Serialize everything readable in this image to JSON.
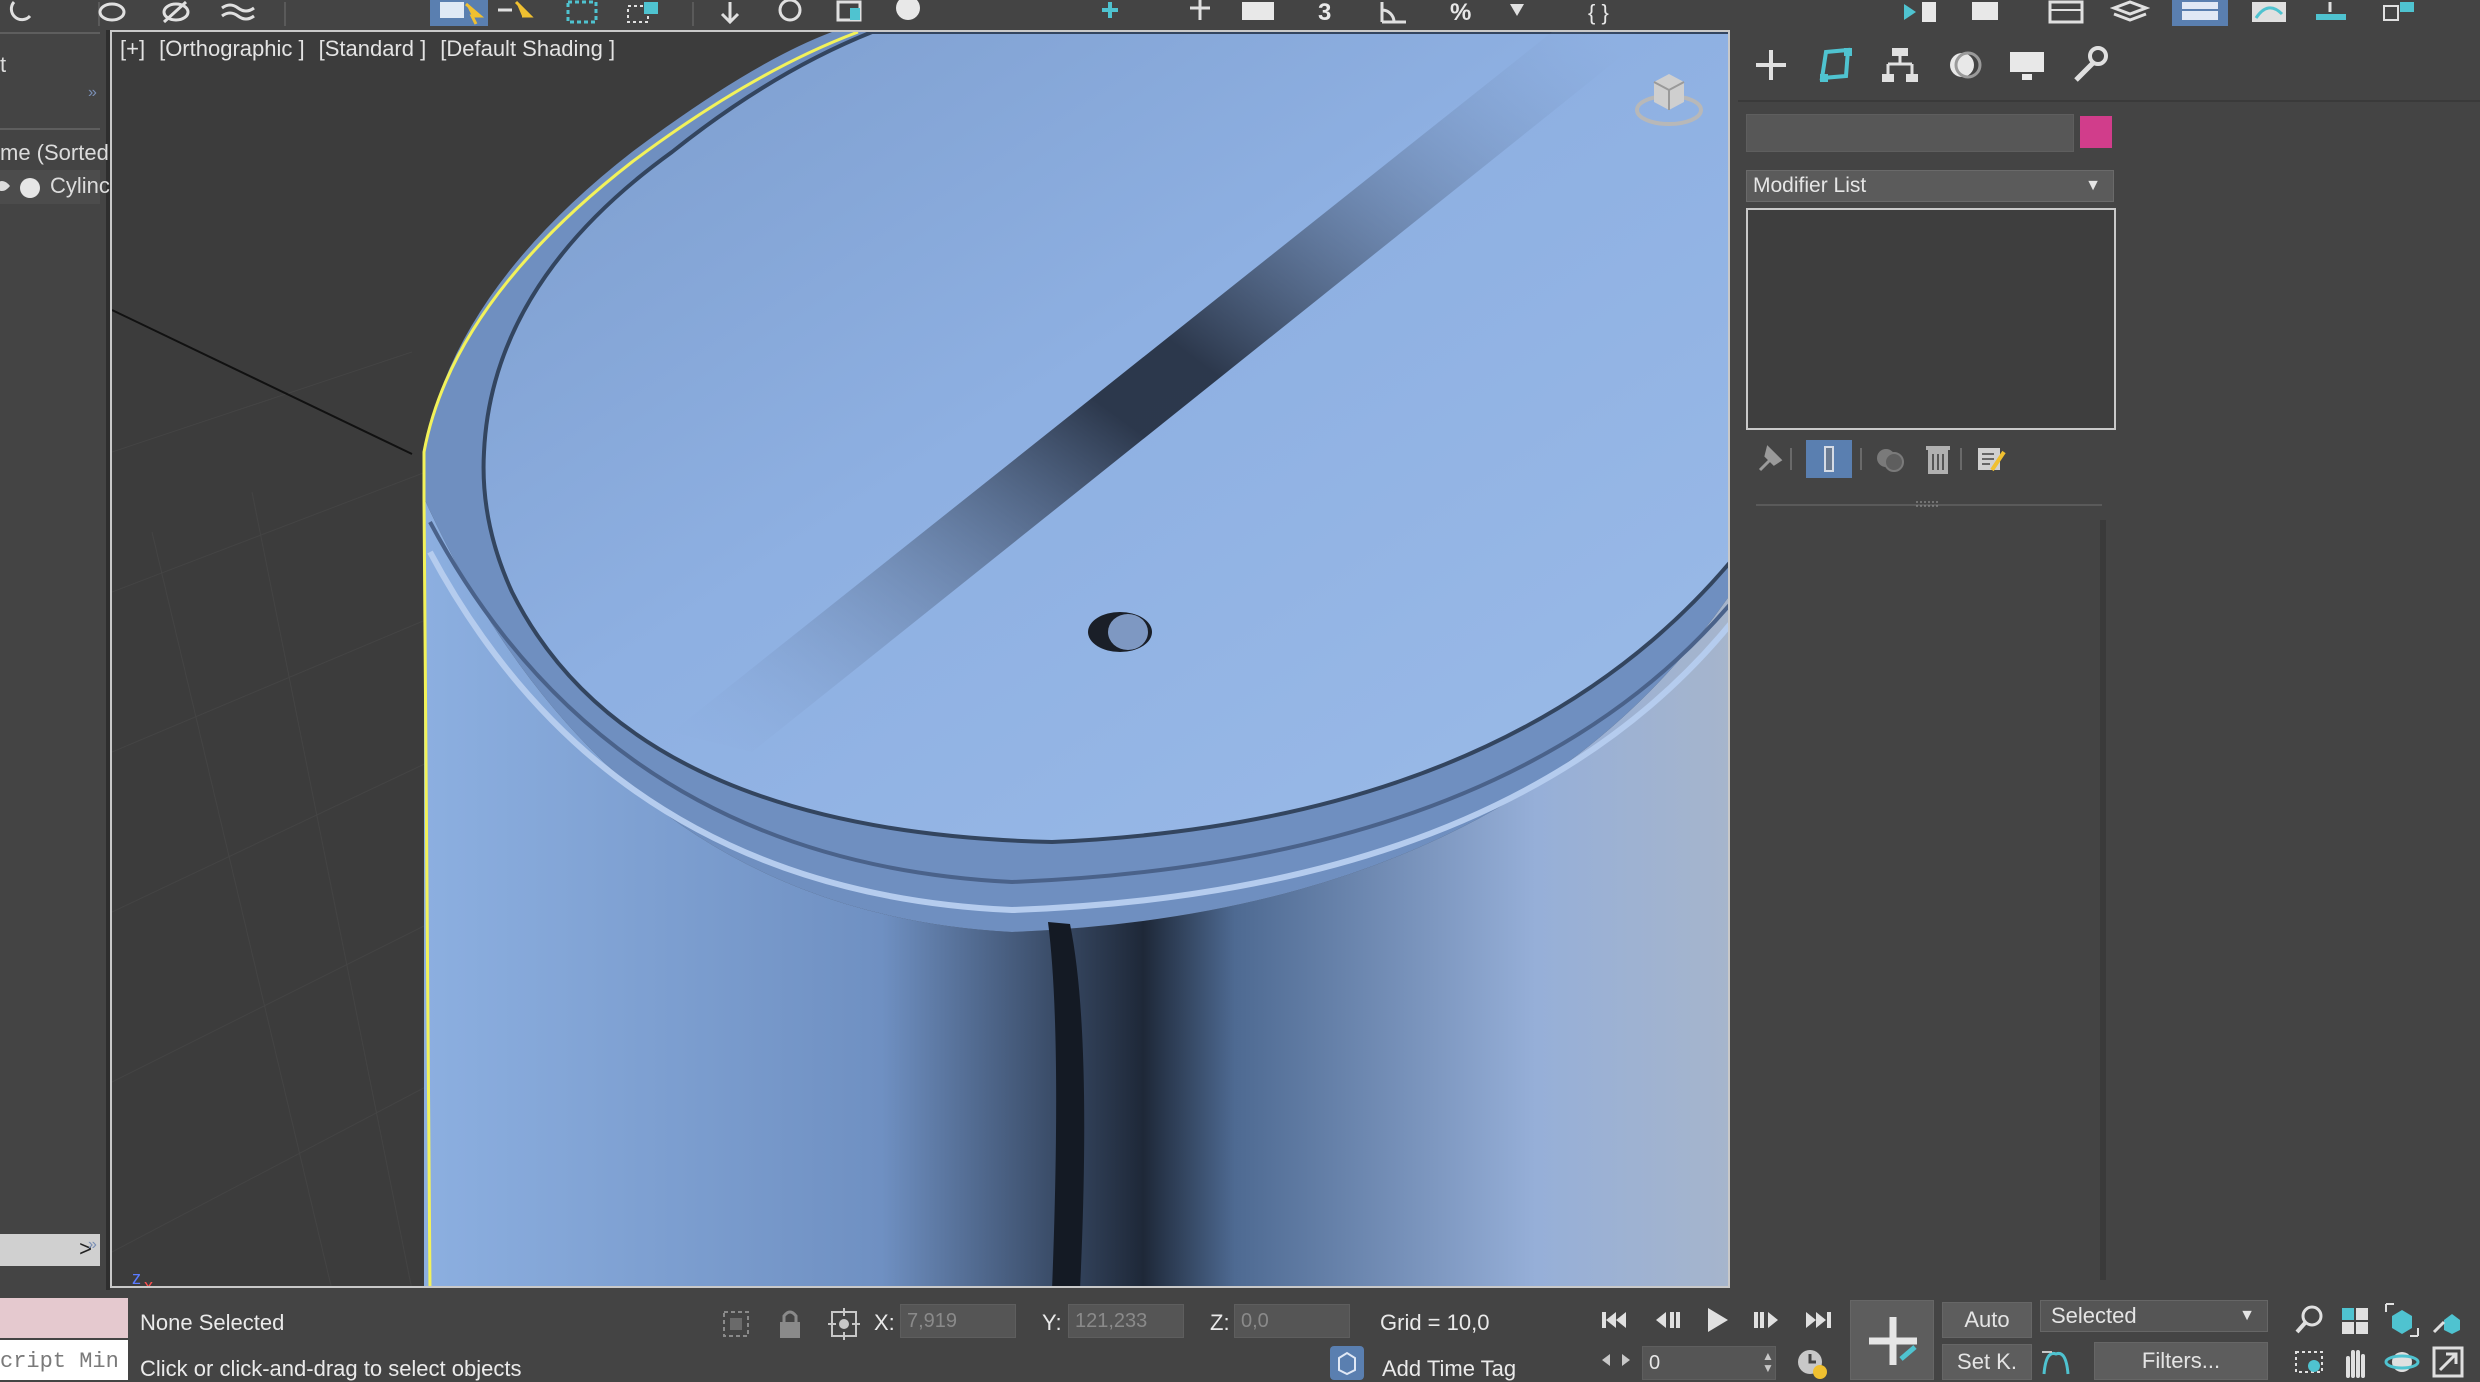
{
  "viewport": {
    "labels": [
      "[+]",
      "[Orthographic ]",
      "[Standard ]",
      "[Default Shading ]"
    ],
    "axis_y": "y",
    "axis_z": "z",
    "axis_x": "x"
  },
  "explorer": {
    "header": "t",
    "sort_label": "me (Sorted",
    "item_label": "Cylinc",
    "scroll_arrow": ">"
  },
  "command_panel": {
    "object_name": "",
    "object_color": "#d13d8b",
    "modifier_list_label": "Modifier List",
    "tabs": [
      "create-icon",
      "modify-icon",
      "hierarchy-icon",
      "motion-icon",
      "display-icon",
      "utilities-icon"
    ]
  },
  "status": {
    "selection": "None Selected",
    "prompt": "Click or click-and-drag to select objects",
    "script_label": "cript Min",
    "x_label": "X:",
    "x_value": "7,919",
    "y_label": "Y:",
    "y_value": "121,233",
    "z_label": "Z:",
    "z_value": "0,0",
    "grid": "Grid = 10,0",
    "add_time_tag": "Add Time Tag",
    "frame": "0",
    "auto_key": "Auto",
    "set_key": "Set K.",
    "key_filter_selected": "Selected",
    "filters": "Filters..."
  },
  "colors": {
    "accent": "#4fc3d0",
    "selection_outline": "#f2f25a",
    "object_blue": "#8fb0e0"
  }
}
